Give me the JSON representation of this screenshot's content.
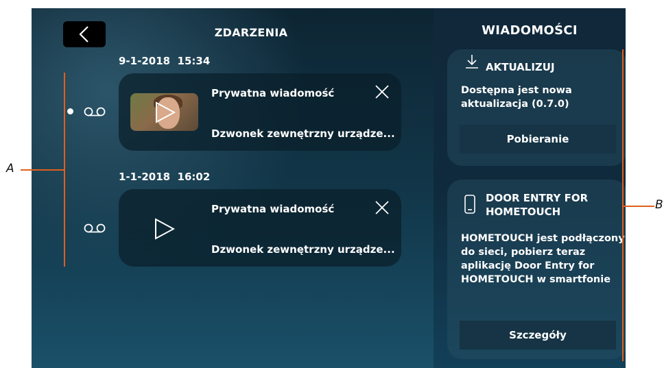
{
  "header": {
    "back_icon": "chevron-left-icon",
    "events_title": "ZDARZENIA",
    "messages_title": "WIADOMOŚCI"
  },
  "events": [
    {
      "date": "9-1-2018  15:34",
      "unread": true,
      "icon": "voicemail-icon",
      "has_thumbnail": true,
      "title": "Prywatna wiadomość",
      "subtitle": "Dzwonek zewnętrzny urządze..."
    },
    {
      "date": "1-1-2018  16:02",
      "unread": false,
      "icon": "voicemail-icon",
      "has_thumbnail": false,
      "title": "Prywatna wiadomość",
      "subtitle": "Dzwonek zewnętrzny urządze..."
    }
  ],
  "messages": [
    {
      "icon": "download-icon",
      "title": "AKTUALIZUJ",
      "body": "Dostępna jest nowa aktualizacja (0.7.0)",
      "button": "Pobieranie"
    },
    {
      "icon": "smartphone-icon",
      "title": "DOOR ENTRY FOR HOMETOUCH",
      "body": "HOMETOUCH jest podłączony do sieci, pobierz teraz aplikację Door Entry for HOMETOUCH w smartfonie",
      "button": "Szczegóły"
    }
  ],
  "annotations": {
    "left_label": "A",
    "right_label": "B",
    "color": "#e35f1a"
  }
}
